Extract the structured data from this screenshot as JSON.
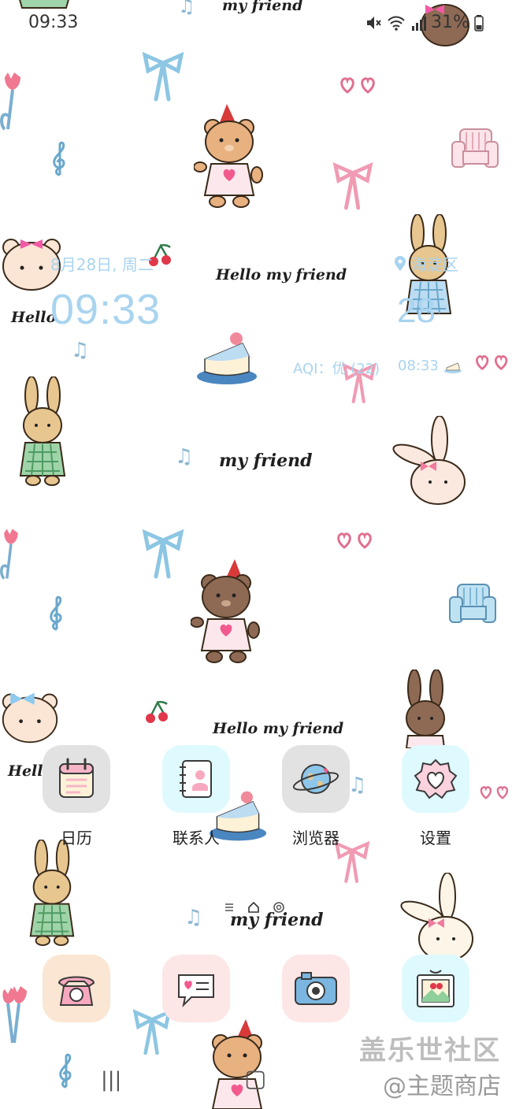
{
  "status_bar": {
    "time": "09:33",
    "battery": "31%"
  },
  "wallpaper": {
    "texts": [
      "my friend",
      "Hello my friend",
      "Hello",
      "my friend",
      "Hello my friend",
      "Hello",
      "my friend"
    ]
  },
  "weather_widget": {
    "date": "8月28日, 周二",
    "time": "09:33",
    "location": "海淀区",
    "temperature": "28",
    "aqi": "AQI：优 (22)",
    "updated": "08:33"
  },
  "home_row": {
    "apps": [
      {
        "label": "日历",
        "icon": "calendar-icon"
      },
      {
        "label": "联系人",
        "icon": "contacts-icon"
      },
      {
        "label": "浏览器",
        "icon": "browser-icon"
      },
      {
        "label": "设置",
        "icon": "settings-icon"
      }
    ]
  },
  "page_indicator": [
    "menu",
    "home",
    "circle"
  ],
  "dock": {
    "apps": [
      {
        "icon": "phone-icon"
      },
      {
        "icon": "messages-icon"
      },
      {
        "icon": "camera-icon"
      },
      {
        "icon": "gallery-icon"
      }
    ]
  },
  "nav_bar": {
    "recent": "|||",
    "home": "▢"
  },
  "watermark": {
    "line1": "盖乐世社区",
    "line2": "@主题商店"
  },
  "colors": {
    "widget_text": "#a9d4ef",
    "background": "#ffffff"
  }
}
